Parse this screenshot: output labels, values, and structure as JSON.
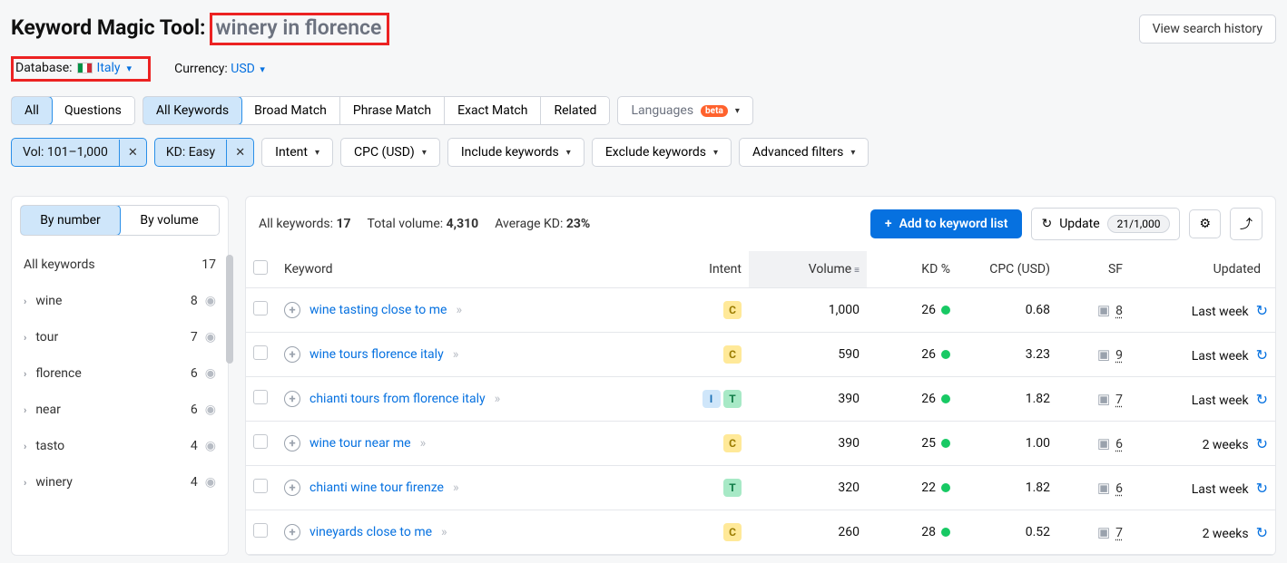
{
  "header": {
    "title_prefix": "Keyword Magic Tool:",
    "query": "winery in florence",
    "view_history": "View search history",
    "database_label": "Database:",
    "database_value": "Italy",
    "currency_label": "Currency:",
    "currency_value": "USD"
  },
  "filters": {
    "row1": {
      "all": "All",
      "questions": "Questions",
      "all_keywords": "All Keywords",
      "broad": "Broad Match",
      "phrase": "Phrase Match",
      "exact": "Exact Match",
      "related": "Related",
      "languages": "Languages",
      "beta": "beta"
    },
    "row2": {
      "vol_chip": "Vol: 101–1,000",
      "kd_chip": "KD: Easy",
      "intent": "Intent",
      "cpc": "CPC (USD)",
      "include": "Include keywords",
      "exclude": "Exclude keywords",
      "advanced": "Advanced filters"
    }
  },
  "sidebar": {
    "by_number": "By number",
    "by_volume": "By volume",
    "all_label": "All keywords",
    "all_count": "17",
    "items": [
      {
        "label": "wine",
        "count": "8"
      },
      {
        "label": "tour",
        "count": "7"
      },
      {
        "label": "florence",
        "count": "6"
      },
      {
        "label": "near",
        "count": "6"
      },
      {
        "label": "tasto",
        "count": "4"
      },
      {
        "label": "winery",
        "count": "4"
      }
    ]
  },
  "main": {
    "stats": {
      "all_label": "All keywords:",
      "all_value": "17",
      "vol_label": "Total volume:",
      "vol_value": "4,310",
      "kd_label": "Average KD:",
      "kd_value": "23%"
    },
    "actions": {
      "add": "Add to keyword list",
      "update": "Update",
      "count": "21/1,000"
    },
    "columns": {
      "keyword": "Keyword",
      "intent": "Intent",
      "volume": "Volume",
      "kd": "KD %",
      "cpc": "CPC (USD)",
      "sf": "SF",
      "updated": "Updated"
    },
    "rows": [
      {
        "kw": "wine tasting close to me",
        "intent": [
          "C"
        ],
        "vol": "1,000",
        "kd": "26",
        "cpc": "0.68",
        "sf": "8",
        "upd": "Last week"
      },
      {
        "kw": "wine tours florence italy",
        "intent": [
          "C"
        ],
        "vol": "590",
        "kd": "26",
        "cpc": "3.23",
        "sf": "9",
        "upd": "Last week"
      },
      {
        "kw": "chianti tours from florence italy",
        "intent": [
          "I",
          "T"
        ],
        "vol": "390",
        "kd": "26",
        "cpc": "1.82",
        "sf": "7",
        "upd": "Last week"
      },
      {
        "kw": "wine tour near me",
        "intent": [
          "C"
        ],
        "vol": "390",
        "kd": "25",
        "cpc": "1.00",
        "sf": "6",
        "upd": "2 weeks"
      },
      {
        "kw": "chianti wine tour firenze",
        "intent": [
          "T"
        ],
        "vol": "320",
        "kd": "22",
        "cpc": "1.82",
        "sf": "6",
        "upd": "Last week"
      },
      {
        "kw": "vineyards close to me",
        "intent": [
          "C"
        ],
        "vol": "260",
        "kd": "28",
        "cpc": "0.52",
        "sf": "7",
        "upd": "2 weeks"
      }
    ]
  }
}
